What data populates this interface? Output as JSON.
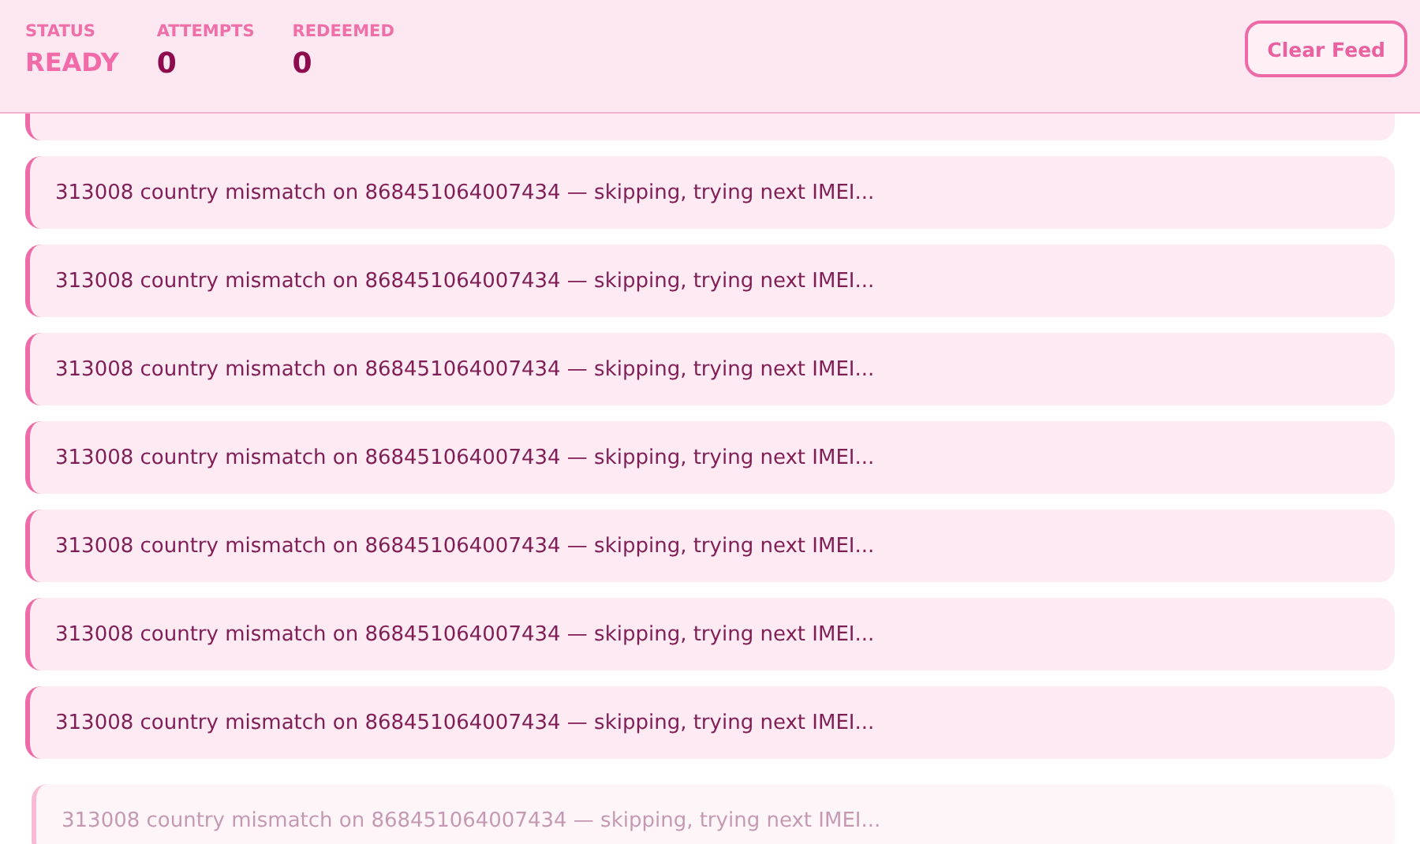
{
  "stats": [
    {
      "label": "STATUS",
      "value": "READY",
      "kind": "status"
    },
    {
      "label": "ATTEMPTS",
      "value": "0",
      "kind": "count"
    },
    {
      "label": "REDEEMED",
      "value": "0",
      "kind": "count"
    }
  ],
  "clear_button": "Clear Feed",
  "feed": [
    {
      "text": "313008 country mismatch on 868451064007434 — skipping, trying next IMEI...",
      "faded": false
    },
    {
      "text": "313008 country mismatch on 868451064007434 — skipping, trying next IMEI...",
      "faded": false
    },
    {
      "text": "313008 country mismatch on 868451064007434 — skipping, trying next IMEI...",
      "faded": false
    },
    {
      "text": "313008 country mismatch on 868451064007434 — skipping, trying next IMEI...",
      "faded": false
    },
    {
      "text": "313008 country mismatch on 868451064007434 — skipping, trying next IMEI...",
      "faded": false
    },
    {
      "text": "313008 country mismatch on 868451064007434 — skipping, trying next IMEI...",
      "faded": false
    },
    {
      "text": "313008 country mismatch on 868451064007434 — skipping, trying next IMEI...",
      "faded": false
    },
    {
      "text": "313008 country mismatch on 868451064007434 — skipping, trying next IMEI...",
      "faded": true
    }
  ]
}
